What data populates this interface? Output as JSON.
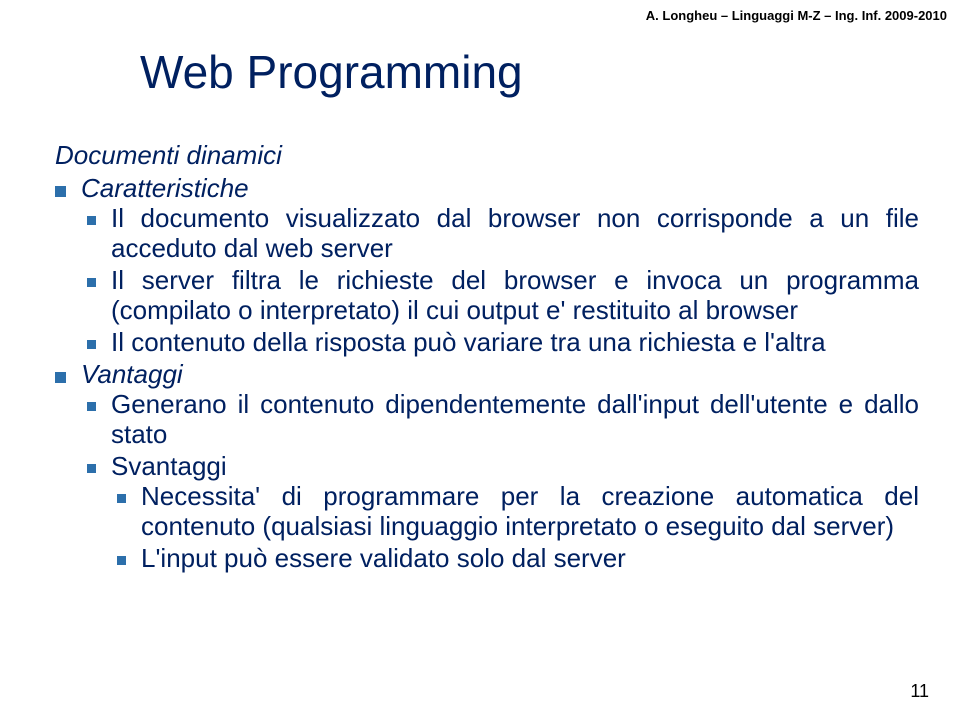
{
  "header": "A. Longheu – Linguaggi M-Z – Ing. Inf.  2009-2010",
  "title": "Web Programming",
  "section1_title": "Documenti dinamici",
  "section1_sub": "Caratteristiche",
  "char_items": [
    "Il documento visualizzato dal browser non corrisponde a un file acceduto dal web server",
    "Il server filtra le richieste del browser e invoca un programma (compilato o interpretato) il cui output e' restituito al browser",
    "Il contenuto della risposta può variare tra una richiesta e l'altra"
  ],
  "section2_sub": "Vantaggi",
  "vant_items": [
    "Generano il contenuto dipendentemente dall'input dell'utente e dallo stato"
  ],
  "svantaggi_label": "Svantaggi",
  "svant_items": [
    "Necessita' di programmare per la creazione automatica del contenuto (qualsiasi linguaggio interpretato o eseguito dal server)",
    "L'input può essere validato solo dal server"
  ],
  "page_number": "11"
}
